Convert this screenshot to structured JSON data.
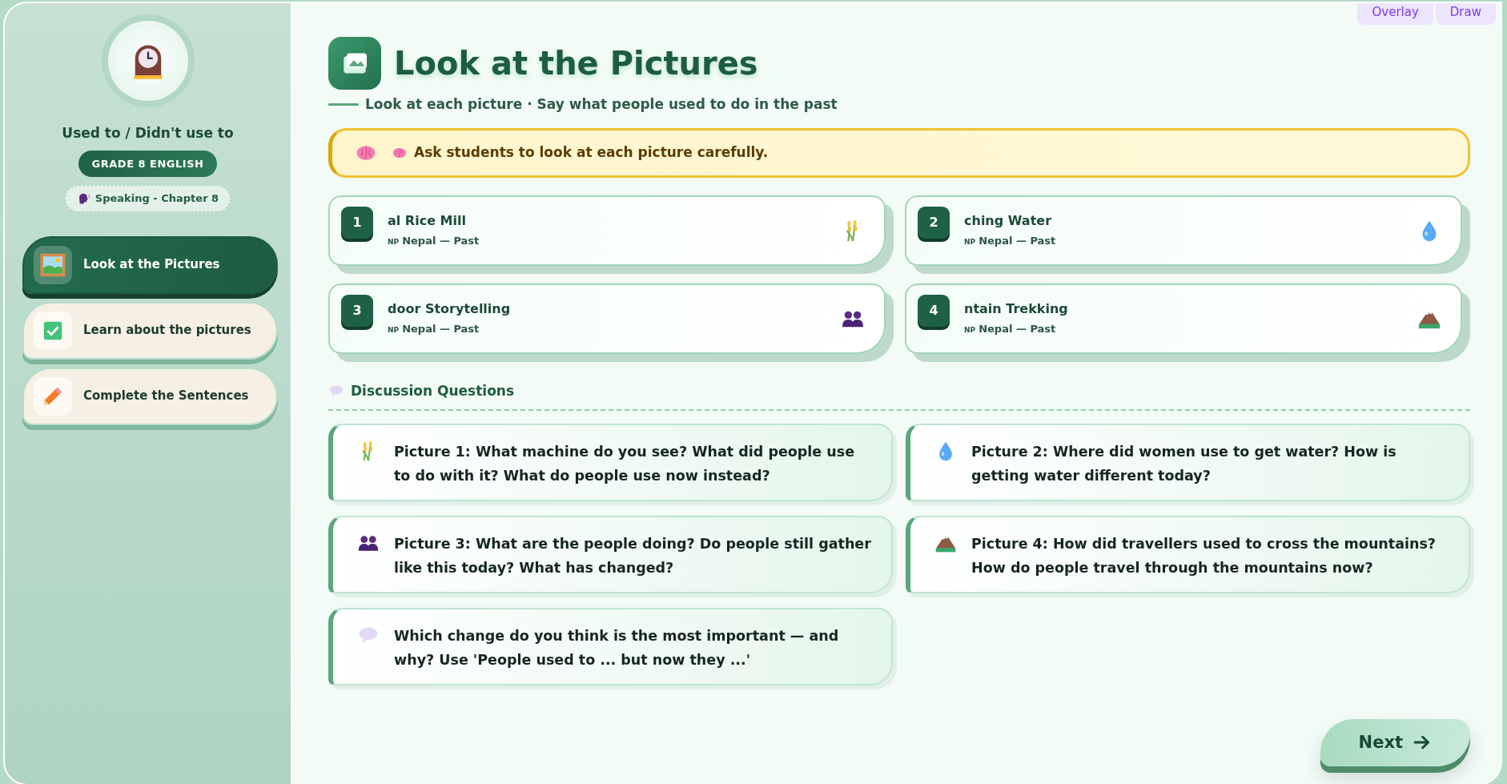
{
  "sidebar": {
    "title": "Used to / Didn't use to",
    "grade": "GRADE 8 ENGLISH",
    "chapter": "Speaking - Chapter 8",
    "steps": [
      {
        "label": "Look at the Pictures",
        "selected": true
      },
      {
        "label": "Learn about the pictures",
        "selected": false
      },
      {
        "label": "Complete the Sentences",
        "selected": false
      }
    ]
  },
  "toolbar": [
    "Overlay",
    "Draw"
  ],
  "header": {
    "title": "Look at the Pictures",
    "subtitle": "Look at each picture · Say what people used to do in the past"
  },
  "tip": {
    "text": "Ask students to look at each picture carefully."
  },
  "pictures": [
    {
      "number": "1",
      "title": "al Rice Mill",
      "flag": "NP",
      "subtitle": "Nepal — Past"
    },
    {
      "number": "2",
      "title": "ching Water",
      "flag": "NP",
      "subtitle": "Nepal — Past"
    },
    {
      "number": "3",
      "title": "door Storytelling",
      "flag": "NP",
      "subtitle": "Nepal — Past"
    },
    {
      "number": "4",
      "title": "ntain Trekking",
      "flag": "NP",
      "subtitle": "Nepal — Past"
    }
  ],
  "discussion": {
    "heading": "Discussion Questions",
    "questions": [
      "Picture 1: What machine do you see? What did people use to do with it? What do people use now instead?",
      "Picture 2: Where did women use to get water? How is getting water different today?",
      "Picture 3: What are the people doing? Do people still gather like this today? What has changed?",
      "Picture 4: How did travellers used to cross the mountains? How do people travel through the mountains now?",
      "Which change do you think is the most important — and why? Use 'People used to ... but now they ...'"
    ]
  },
  "next_button": "Next"
}
